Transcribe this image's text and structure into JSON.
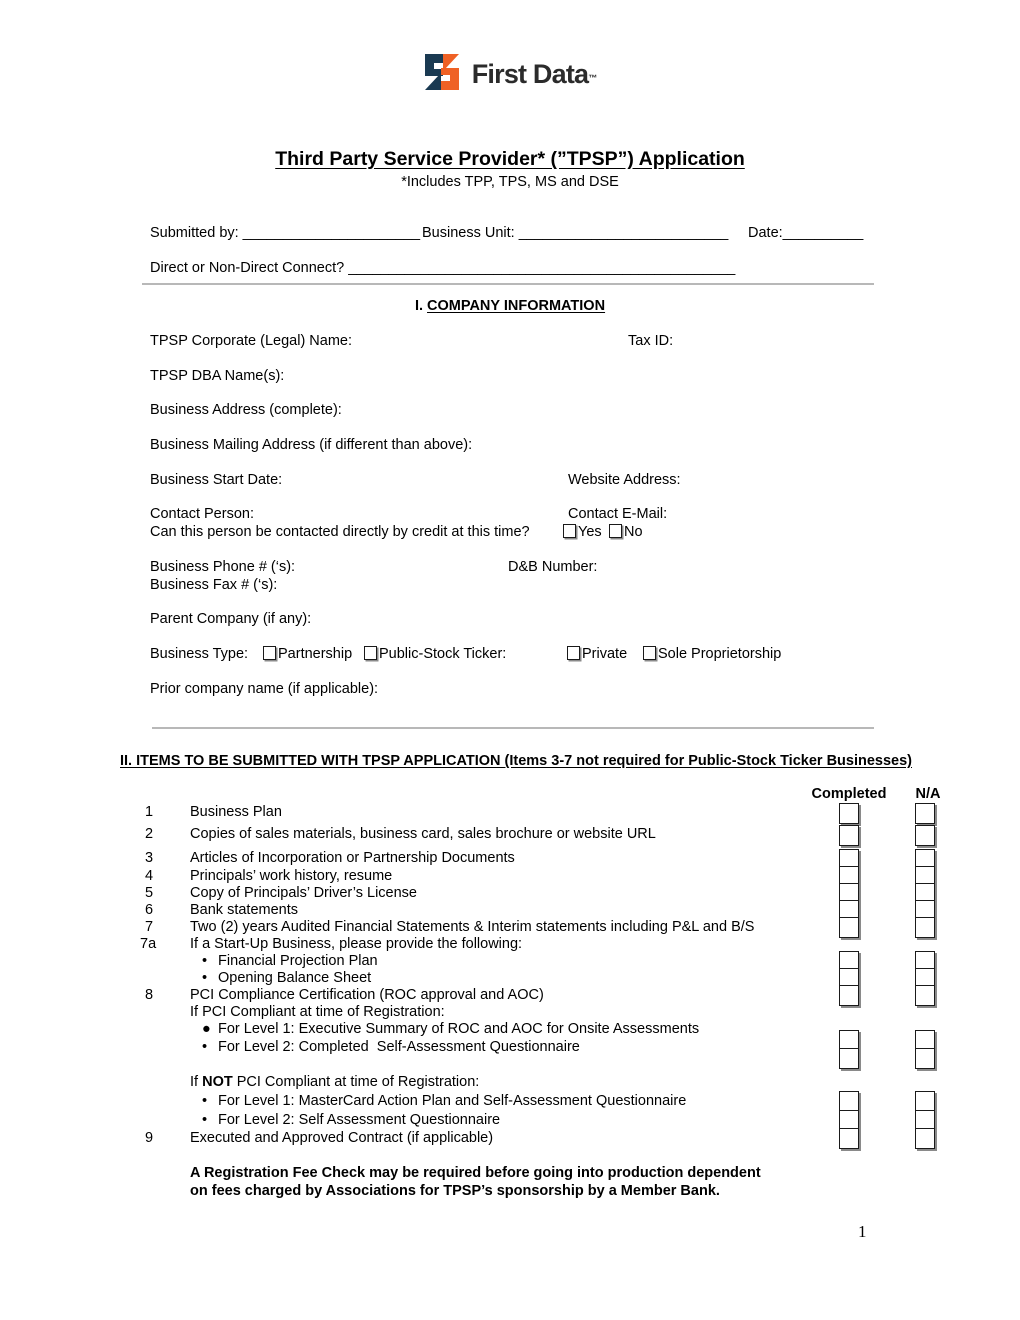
{
  "logo": {
    "name": "First Data",
    "trademark": "™",
    "navy": "#1a3a52",
    "orange": "#ef6125"
  },
  "title": {
    "main": "Third Party Service Provider* (”TPSP”) Application",
    "sub": "*Includes TPP, TPS, MS and DSE"
  },
  "submission": {
    "submitted_by_label": "Submitted by: ______________________",
    "business_unit_label": "Business Unit: __________________________",
    "date_label": "Date:__________",
    "connect_label": "Direct or Non-Direct Connect? ________________________________________________"
  },
  "section1": {
    "heading_prefix": "I. ",
    "heading": "COMPANY INFORMATION",
    "fields": [
      {
        "label": "TPSP Corporate (Legal) Name:",
        "right": "Tax ID:"
      },
      {
        "label": "TPSP DBA Name(s):",
        "right": ""
      },
      {
        "label": "Business Address (complete):",
        "right": ""
      },
      {
        "label": "Business Mailing Address (if different than above):",
        "right": ""
      },
      {
        "label": "Business Start Date:",
        "right": "Website Address:"
      },
      {
        "label": "Contact Person:",
        "right": "Contact E-Mail:"
      }
    ],
    "contact_question": "Can this person be contacted directly by credit at this time?",
    "yes_label": "Yes",
    "no_label": "No",
    "phone_label": "Business Phone # (‘s):",
    "dnb_label": "D&B Number:",
    "fax_label": "Business Fax # (‘s):",
    "parent_label": "Parent Company (if any):",
    "business_type_label": "Business Type:",
    "business_type_options": [
      "Partnership",
      "Public-Stock Ticker:",
      "Private",
      "Sole Proprietorship"
    ],
    "prior_name_label": "Prior company name (if applicable):"
  },
  "section2": {
    "heading_bold": "II. ITEMS TO BE SUBMITTED WITH TPSP APPLICATION",
    "heading_rest": " (Items 3-7 not required for Public-Stock Ticker Businesses)",
    "col_completed": "Completed",
    "col_na": "N/A",
    "items": [
      {
        "num": "1",
        "text": "Business Plan"
      },
      {
        "num": "2",
        "text": "Copies of sales materials, business card, sales brochure or website URL"
      },
      {
        "num": "3",
        "text": "Articles of Incorporation or Partnership Documents"
      },
      {
        "num": "4",
        "text": "Principals’ work history, resume"
      },
      {
        "num": "5",
        "text": "Copy of Principals’ Driver’s License"
      },
      {
        "num": "6",
        "text": "Bank statements"
      },
      {
        "num": "7",
        "text": "Two (2) years Audited Financial Statements & Interim statements including P&L and B/S"
      },
      {
        "num": "7a",
        "text": "If a Start-Up Business, please provide the following:"
      }
    ],
    "startup_bullets": [
      {
        "marker": "•",
        "text": "Financial Projection Plan"
      },
      {
        "marker": "•",
        "text": "Opening Balance Sheet"
      }
    ],
    "item8": {
      "num": "8",
      "text": "PCI Compliance Certification (ROC approval and AOC)"
    },
    "pci_compliant_heading": "If PCI Compliant at time of Registration:",
    "pci_compliant_bullets": [
      {
        "marker": "●",
        "text": "For Level 1: Executive Summary of ROC and AOC for Onsite Assessments"
      },
      {
        "marker": "•",
        "text": "For Level 2: Completed  Self-Assessment Questionnaire"
      }
    ],
    "pci_not_heading_pre": "If ",
    "pci_not_heading_bold": "NOT",
    "pci_not_heading_post": " PCI Compliant at time of Registration:",
    "pci_not_bullets": [
      {
        "marker": "•",
        "text": "For Level 1: MasterCard Action Plan and Self-Assessment Questionnaire"
      },
      {
        "marker": "•",
        "text": "For Level 2: Self Assessment Questionnaire"
      }
    ],
    "item9": {
      "num": "9",
      "text": "Executed and Approved Contract (if applicable)"
    },
    "footnote_line1": "A Registration Fee Check may be required before going into production dependent",
    "footnote_line2": "on fees charged by Associations for TPSP’s sponsorship by a Member Bank."
  },
  "page_number": "1"
}
